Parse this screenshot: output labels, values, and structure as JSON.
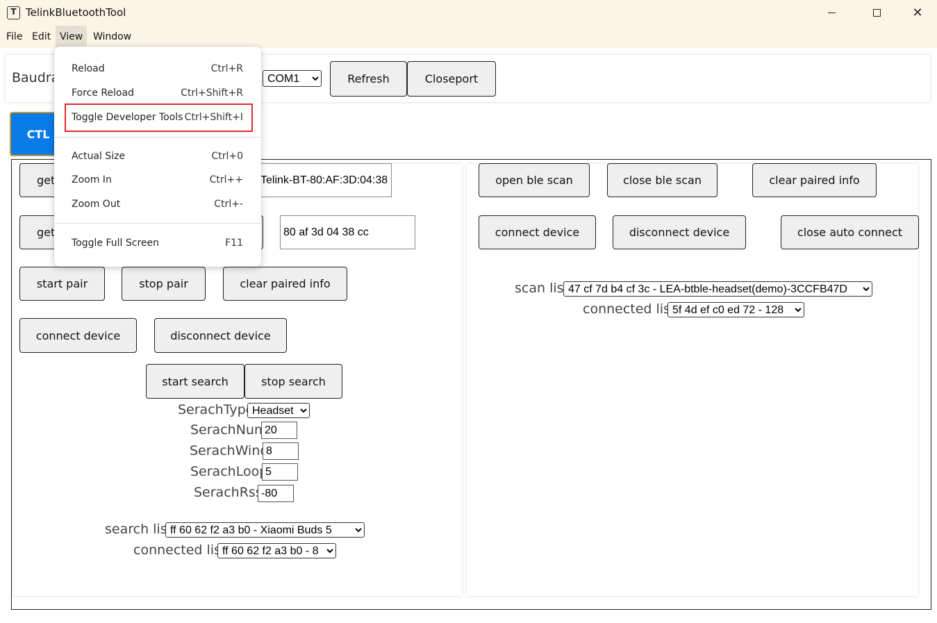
{
  "window": {
    "title": "TelinkBluetoothTool",
    "icon_glyph": "T",
    "controls": {
      "close_glyph": "✕"
    }
  },
  "menubar": {
    "items": [
      "File",
      "Edit",
      "View",
      "Window"
    ]
  },
  "toolbar": {
    "baud_label": "Baudra",
    "port_select": "COM1",
    "refresh_label": "Refresh",
    "closeport_label": "Closeport"
  },
  "tabs": [
    {
      "label": "CTL",
      "active": true
    }
  ],
  "left": {
    "get_btn_1": "get",
    "name_value": "Telink-BT-80:AF:3D:04:38",
    "get_btn_2": "get",
    "mac_value": "80 af 3d 04 38 cc",
    "start_pair": "start pair",
    "stop_pair": "stop pair",
    "clear_paired": "clear paired info",
    "connect": "connect device",
    "disconnect": "disconnect device",
    "start_search": "start search",
    "stop_search": "stop search",
    "search_type_label": "SerachType",
    "search_type_value": "Headset",
    "search_num_label": "SerachNum",
    "search_num_value": "20",
    "search_wind_label": "SerachWind",
    "search_wind_value": "8",
    "search_loop_label": "SerachLoop",
    "search_loop_value": "5",
    "search_rssi_label": "SerachRssi",
    "search_rssi_value": "-80",
    "search_list_label": "search list",
    "search_list_value": "ff 60 62 f2 a3 b0 - Xiaomi Buds 5",
    "connected_list_label": "connected list",
    "connected_list_value": "ff 60 62 f2 a3 b0 - 8"
  },
  "right": {
    "open_ble_scan": "open ble scan",
    "close_ble_scan": "close ble scan",
    "clear_paired": "clear paired info",
    "connect": "connect device",
    "disconnect": "disconnect device",
    "close_auto_connect": "close auto connect",
    "scan_list_label": "scan list",
    "scan_list_value": "47 cf 7d b4 cf 3c - LEA-btble-headset(demo)-3CCFB47D",
    "connected_list_label": "connected list",
    "connected_list_value": "5f 4d ef c0 ed 72 - 128"
  },
  "view_menu": {
    "items": [
      {
        "label": "Reload",
        "shortcut": "Ctrl+R"
      },
      {
        "label": "Force Reload",
        "shortcut": "Ctrl+Shift+R"
      },
      {
        "label": "Toggle Developer Tools",
        "shortcut": "Ctrl+Shift+I",
        "highlighted": true
      },
      {
        "label": "Actual Size",
        "shortcut": "Ctrl+0"
      },
      {
        "label": "Zoom In",
        "shortcut": "Ctrl++"
      },
      {
        "label": "Zoom Out",
        "shortcut": "Ctrl+-"
      },
      {
        "label": "Toggle Full Screen",
        "shortcut": "F11"
      }
    ]
  },
  "colors": {
    "tab_active": "#0a7be8",
    "highlight": "#e0282d",
    "titlebar": "#fbf5e6"
  }
}
